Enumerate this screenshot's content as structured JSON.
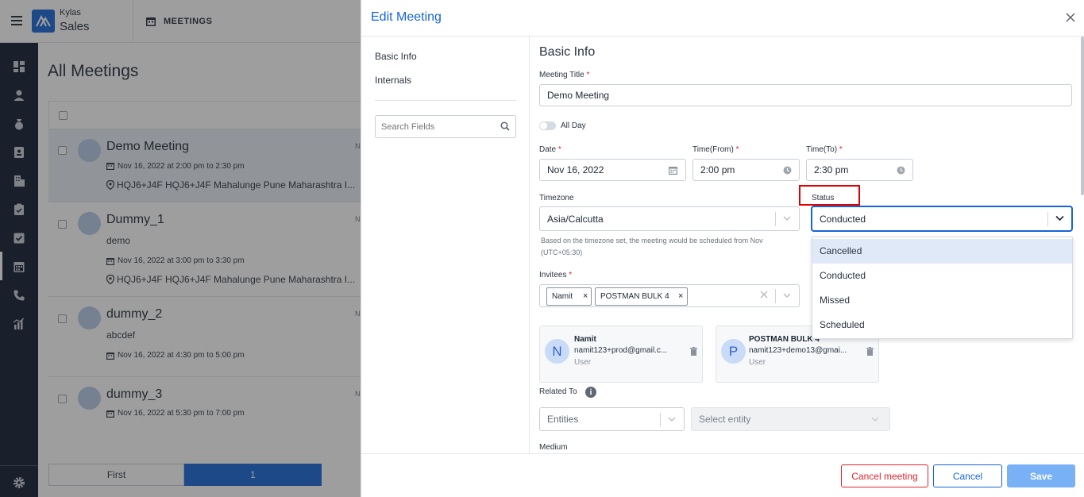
{
  "app": {
    "brand_top": "Kylas",
    "brand_bottom": "Sales",
    "module_title": "MEETINGS"
  },
  "page": {
    "heading": "All Meetings"
  },
  "meetings": [
    {
      "title": "Demo Meeting",
      "desc": "",
      "time": "Nov 16, 2022 at 2:00 pm to 2:30 pm",
      "location": "HQJ6+J4F HQJ6+J4F Mahalunge Pune Maharashtra I..."
    },
    {
      "title": "Dummy_1",
      "desc": "demo",
      "time": "Nov 16, 2022 at 3:00 pm to 3:30 pm",
      "location": "HQJ6+J4F HQJ6+J4F Mahalunge Pune Maharashtra I..."
    },
    {
      "title": "dummy_2",
      "desc": "abcdef",
      "time": "Nov 16, 2022 at 4:30 pm to 5:00 pm",
      "location": ""
    },
    {
      "title": "dummy_3",
      "desc": "",
      "time": "Nov 16, 2022 at 5:30 pm to 7:00 pm",
      "location": ""
    }
  ],
  "meeting_col_letter": "N",
  "pagination": {
    "first": "First",
    "current": "1"
  },
  "modal": {
    "title": "Edit Meeting",
    "nav": [
      "Basic Info",
      "Internals"
    ],
    "search_placeholder": "Search Fields",
    "section_title": "Basic Info",
    "meeting_title_label": "Meeting Title",
    "meeting_title_value": "Demo Meeting",
    "all_day_label": "All Day",
    "date_label": "Date",
    "date_value": "Nov 16, 2022",
    "time_from_label": "Time(From)",
    "time_from_value": "2:00 pm",
    "time_to_label": "Time(To)",
    "time_to_value": "2:30 pm",
    "timezone_label": "Timezone",
    "timezone_value": "Asia/Calcutta",
    "timezone_note_1": "Based on the timezone set, the meeting would be scheduled from Nov",
    "timezone_note_2": "(UTC+05:30)",
    "status_label": "Status",
    "status_value": "Conducted",
    "status_options": [
      "Cancelled",
      "Conducted",
      "Missed",
      "Scheduled"
    ],
    "invitees_label": "Invitees",
    "invitee_chips": [
      "Namit",
      "POSTMAN BULK 4"
    ],
    "invitee_cards": [
      {
        "initial": "N",
        "name": "Namit",
        "email": "namit123+prod@gmail.c...",
        "role": "User"
      },
      {
        "initial": "P",
        "name": "POSTMAN BULK 4",
        "email": "namit123+demo13@gmai...",
        "role": "User"
      }
    ],
    "related_to_label": "Related To",
    "entities_placeholder": "Entities",
    "select_entity_placeholder": "Select entity",
    "medium_label": "Medium",
    "cancel_meeting_label": "Cancel meeting",
    "cancel_label": "Cancel",
    "save_label": "Save"
  },
  "colors": {
    "primary": "#1565d8",
    "sidebar": "#0f1a2f",
    "danger": "#e0242e",
    "save_bg": "#78b1f5",
    "highlight_box": "#e00000"
  }
}
